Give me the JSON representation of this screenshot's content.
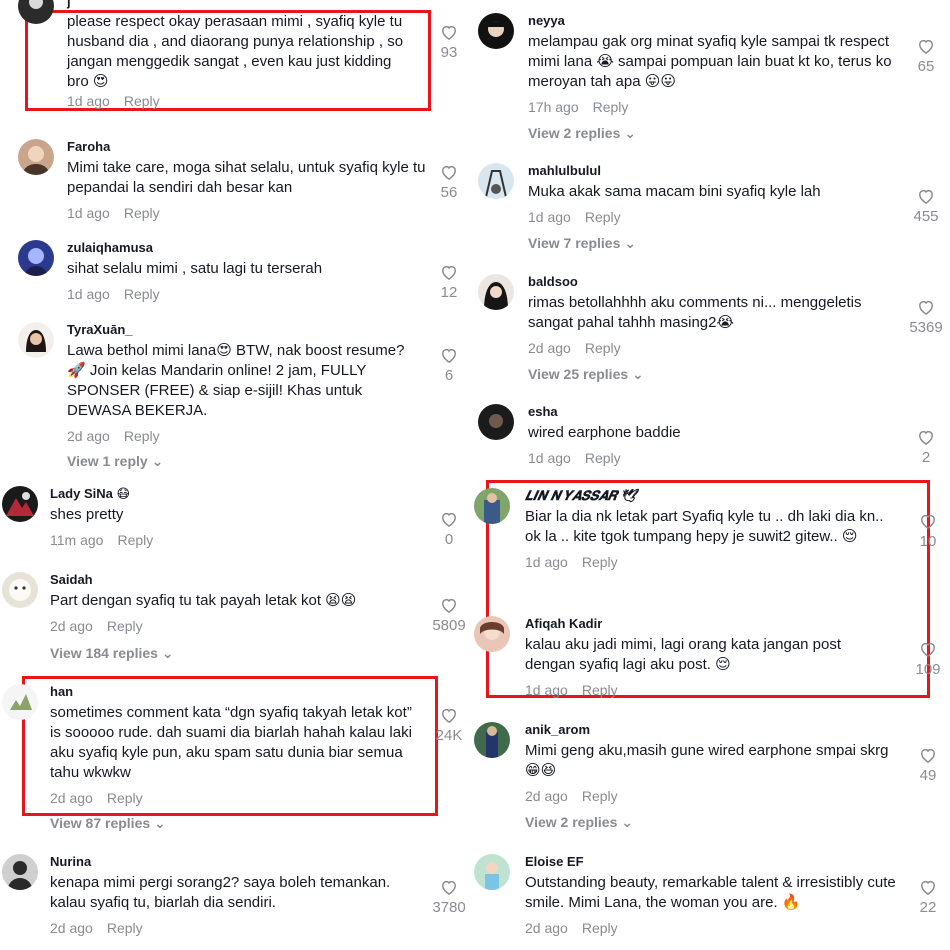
{
  "colors": {
    "highlight": "#e8151b",
    "meta": "#8a8b91",
    "text": "#161823"
  },
  "reply_label": "Reply",
  "comments": [
    {
      "user": "j",
      "text": "please respect okay perasaan mimi , syafiq kyle tu husband dia , and diaorang punya relationship , so jangan menggedik sangat , even kau just kidding bro 😍",
      "time": "1d ago",
      "likes": "93",
      "view_replies": ""
    },
    {
      "user": "Faroha",
      "text": "Mimi take care, moga sihat selalu, untuk syafiq kyle tu pepandai la sendiri dah besar kan",
      "time": "1d ago",
      "likes": "56",
      "view_replies": ""
    },
    {
      "user": "zulaiqhamusa",
      "text": "sihat selalu mimi , satu lagi tu terserah",
      "time": "1d ago",
      "likes": "12",
      "view_replies": ""
    },
    {
      "user": "TyraXuān_",
      "text": "Lawa bethol mimi lana😍 BTW, nak boost resume? 🚀 Join kelas Mandarin online! 2 jam, FULLY SPONSER (FREE) & siap e-sijil! Khas untuk DEWASA BEKERJA.",
      "time": "2d ago",
      "likes": "6",
      "view_replies": "View 1 reply ⌄"
    },
    {
      "user": "Lady SiNa 😷",
      "text": "shes pretty",
      "time": "11m ago",
      "likes": "0",
      "view_replies": ""
    },
    {
      "user": "Saidah",
      "text": "Part dengan syafiq tu tak payah letak kot 😫😫",
      "time": "2d ago",
      "likes": "5809",
      "view_replies": "View 184 replies ⌄"
    },
    {
      "user": "han",
      "text": "sometimes comment kata “dgn syafiq takyah letak kot” is sooooo rude. dah suami dia biarlah hahah kalau laki aku syafiq kyle pun, aku spam satu dunia biar semua tahu wkwkw",
      "time": "2d ago",
      "likes": "24K",
      "view_replies": "View 87 replies ⌄"
    },
    {
      "user": "Nurina",
      "text": "kenapa mimi pergi sorang2? saya boleh temankan. kalau syafiq tu, biarlah dia sendiri.",
      "time": "2d ago",
      "likes": "3780",
      "view_replies": ""
    },
    {
      "user": "neyya",
      "text": "melampau gak org minat syafiq kyle sampai tk respect mimi lana 😭 sampai pompuan lain buat kt ko, terus ko meroyan tah apa 😛😛",
      "time": "17h ago",
      "likes": "65",
      "view_replies": "View 2 replies ⌄"
    },
    {
      "user": "mahlulbulul",
      "text": "Muka akak sama macam bini syafiq kyle lah",
      "time": "1d ago",
      "likes": "455",
      "view_replies": "View 7 replies ⌄"
    },
    {
      "user": "baldsoo",
      "text": "rimas betollahhhh aku comments ni... menggeletis sangat pahal tahhh masing2😭",
      "time": "2d ago",
      "likes": "5369",
      "view_replies": "View 25 replies ⌄"
    },
    {
      "user": "esha",
      "text": "wired earphone baddie",
      "time": "1d ago",
      "likes": "2",
      "view_replies": ""
    },
    {
      "user": "𝑳𝑰𝑵 𝑵 𝒀𝑨𝑺𝑺𝑨𝑹 🕊",
      "text": "Biar la dia nk letak part Syafiq kyle tu .. dh laki dia kn.. ok la .. kite tgok tumpang hepy je suwit2 gitew.. 😌",
      "time": "1d ago",
      "likes": "10",
      "view_replies": ""
    },
    {
      "user": "Afiqah Kadir",
      "text": "kalau aku jadi mimi, lagi orang kata jangan post dengan syafiq lagi aku post. 😌",
      "time": "1d ago",
      "likes": "109",
      "view_replies": ""
    },
    {
      "user": "anik_arom",
      "text": "Mimi geng aku,masih gune wired earphone smpai skrg 😁😆",
      "time": "2d ago",
      "likes": "49",
      "view_replies": "View 2 replies ⌄"
    },
    {
      "user": "Eloise EF",
      "text": "Outstanding beauty, remarkable talent & irresistibly cute smile. Mimi Lana, the woman you are. 🔥",
      "time": "2d ago",
      "likes": "22",
      "view_replies": ""
    }
  ]
}
